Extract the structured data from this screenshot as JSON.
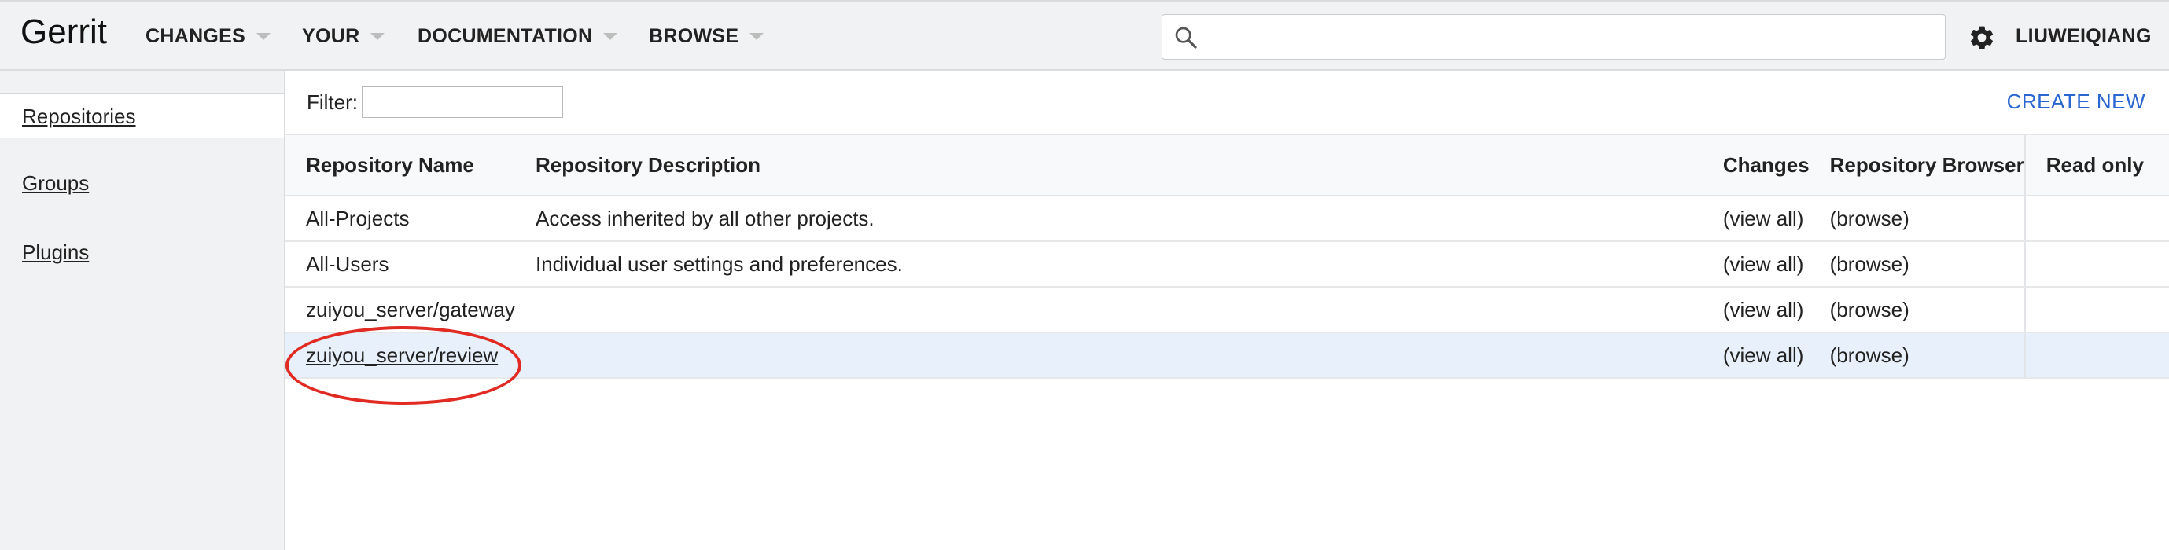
{
  "header": {
    "logo": "Gerrit",
    "nav": [
      {
        "label": "CHANGES"
      },
      {
        "label": "YOUR"
      },
      {
        "label": "DOCUMENTATION"
      },
      {
        "label": "BROWSE"
      }
    ],
    "search": {
      "value": "",
      "placeholder": "",
      "icon": "search-icon"
    },
    "settings_icon": "gear-icon",
    "user": "LIUWEIQIANG"
  },
  "sidebar": {
    "items": [
      {
        "label": "Repositories",
        "active": true
      },
      {
        "label": "Groups",
        "active": false
      },
      {
        "label": "Plugins",
        "active": false
      }
    ]
  },
  "main": {
    "filter_label": "Filter:",
    "filter_value": "",
    "create_new": "CREATE NEW",
    "columns": [
      "Repository Name",
      "Repository Description",
      "Changes",
      "Repository Browser",
      "Read only"
    ],
    "rows": [
      {
        "name": "All-Projects",
        "description": "Access inherited by all other projects.",
        "changes": "(view all)",
        "browser": "(browse)",
        "read_only": ""
      },
      {
        "name": "All-Users",
        "description": "Individual user settings and preferences.",
        "changes": "(view all)",
        "browser": "(browse)",
        "read_only": ""
      },
      {
        "name": "zuiyou_server/gateway",
        "description": "",
        "changes": "(view all)",
        "browser": "(browse)",
        "read_only": ""
      },
      {
        "name": "zuiyou_server/review",
        "description": "",
        "changes": "(view all)",
        "browser": "(browse)",
        "read_only": ""
      }
    ]
  },
  "colors": {
    "header_bg": "#f1f2f3",
    "link_blue": "#2a66d1",
    "selected_row": "#e8f0fb",
    "annotation_red": "#e02a22"
  }
}
